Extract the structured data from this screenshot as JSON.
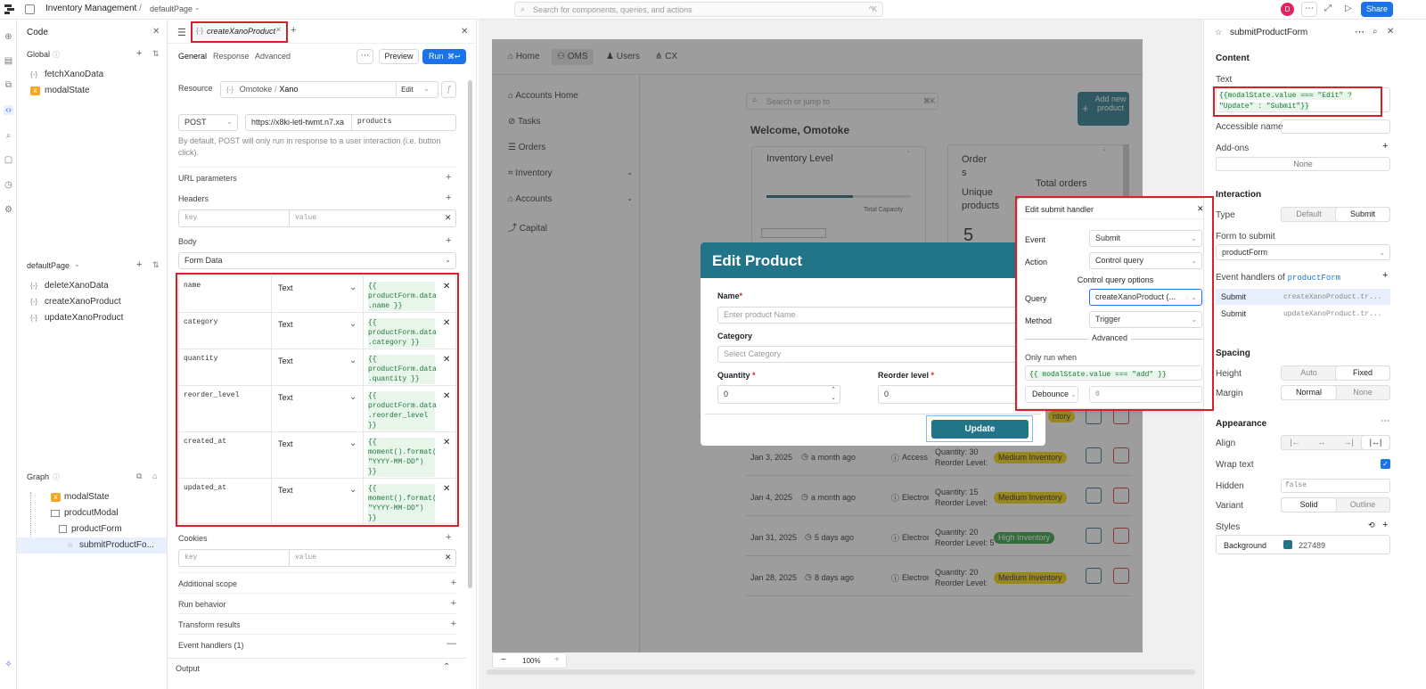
{
  "topbar": {
    "app_title": "Inventory Management",
    "separator": "/",
    "page": "defaultPage",
    "search_placeholder": "Search for components, queries, and actions",
    "search_shortcut": "^K",
    "avatar_initial": "D",
    "share_label": "Share"
  },
  "left_panel": {
    "title": "Code",
    "global_label": "Global",
    "global_items": [
      {
        "label": "fetchXanoData",
        "icon": "query-icon"
      },
      {
        "label": "modalState",
        "icon": "variable-icon"
      }
    ],
    "page_label": "defaultPage",
    "page_items": [
      {
        "label": "deleteXanoData"
      },
      {
        "label": "createXanoProduct"
      },
      {
        "label": "updateXanoProduct"
      }
    ],
    "graph_label": "Graph",
    "graph_items": [
      {
        "label": "modalState"
      },
      {
        "label": "prodcutModal"
      },
      {
        "label": "productForm"
      },
      {
        "label": "submitProductFo..."
      }
    ]
  },
  "query_panel": {
    "tab_name": "createXanoProduct",
    "tabs": [
      "General",
      "Response",
      "Advanced"
    ],
    "preview_label": "Preview",
    "run_label": "Run",
    "run_shortcut": "⌘↩",
    "resource_label": "Resource",
    "resource_owner": "Omotoke",
    "resource_sep": "/",
    "resource_name": "Xano",
    "resource_edit": "Edit",
    "method": "POST",
    "url": "https://x8ki-letl-twmt.n7.xa",
    "path": "products",
    "post_note": "By default, POST will only run in response to a user interaction (i.e. button click).",
    "url_params_label": "URL parameters",
    "headers_label": "Headers",
    "key_placeholder": "key",
    "value_placeholder": "value",
    "body_label": "Body",
    "body_type": "Form Data",
    "body_rows": [
      {
        "key": "name",
        "type": "Text",
        "value": "{{ productForm.data .name }}"
      },
      {
        "key": "category",
        "type": "Text",
        "value": "{{ productForm.data .category }}"
      },
      {
        "key": "quantity",
        "type": "Text",
        "value": "{{ productForm.data .quantity }}"
      },
      {
        "key": "reorder_level",
        "type": "Text",
        "value": "{{ productForm.data .reorder_level }}"
      },
      {
        "key": "created_at",
        "type": "Text",
        "value": "{{ moment().format( \"YYYY-MM-DD\") }}"
      },
      {
        "key": "updated_at",
        "type": "Text",
        "value": "{{ moment().format( \"YYYY-MM-DD\") }}"
      }
    ],
    "cookies_label": "Cookies",
    "sections": [
      "Additional scope",
      "Run behavior",
      "Transform results",
      "Event handlers (1)"
    ],
    "output_label": "Output"
  },
  "app": {
    "nav": [
      "Home",
      "OMS",
      "Users",
      "CX"
    ],
    "sidebar": [
      "Accounts Home",
      "Tasks",
      "Orders",
      "Inventory",
      "Accounts",
      "Capital"
    ],
    "search_placeholder": "Search or jump to",
    "search_shortcut": "⌘K",
    "add_button": "Add new product",
    "welcome": "Welcome, Omotoke",
    "inventory_card_title": "Inventory Level",
    "total_capacity": "Total Capacity",
    "orders_card_title": "Orders",
    "unique_products": "Unique products",
    "total_orders": "Total orders",
    "unique_count": "5",
    "inventory_fill": 0.6,
    "rows": [
      {
        "date": "Jan 3, 2025",
        "ago": "a month ago",
        "cat": "Access",
        "qty": "Quantity: 30",
        "reorder": "Reorder Level:",
        "status": "Medium Inventory"
      },
      {
        "date": "Jan 4, 2025",
        "ago": "a month ago",
        "cat": "Electron",
        "qty": "Quantity: 15",
        "reorder": "Reorder Level:",
        "status": "Medium Inventory"
      },
      {
        "date": "Jan 31, 2025",
        "ago": "5 days ago",
        "cat": "Electron",
        "qty": "Quantity: 20",
        "reorder": "Reorder Level: 5",
        "status": "High Inventory"
      },
      {
        "date": "Jan 28, 2025",
        "ago": "8 days ago",
        "cat": "Electron",
        "qty": "Quantity: 20",
        "reorder": "Reorder Level:",
        "status": "Medium Inventory"
      }
    ],
    "partial_status": "ntory",
    "zoom": "100%"
  },
  "modal": {
    "title": "Edit Product",
    "name_label": "Name",
    "name_placeholder": "Enter product Name",
    "category_label": "Category",
    "category_placeholder": "Select Category",
    "quantity_label": "Quantity",
    "quantity_value": "0",
    "reorder_label": "Reorder level",
    "reorder_value": "0",
    "required_mark": "*",
    "update_label": "Update"
  },
  "handler_popup": {
    "title": "Edit submit handler",
    "event_label": "Event",
    "event_value": "Submit",
    "action_label": "Action",
    "action_value": "Control query",
    "options_label": "Control query options",
    "query_label": "Query",
    "query_value": "createXanoProduct (...",
    "method_label": "Method",
    "method_value": "Trigger",
    "advanced_label": "Advanced",
    "only_run_label": "Only run when",
    "only_run_value": "{{ modalState.value === \"add\" }}",
    "debounce_label": "Debounce",
    "debounce_value": "0"
  },
  "inspector": {
    "title": "submitProductForm",
    "content_label": "Content",
    "text_label": "Text",
    "text_value": "{{modalState.value === \"Edit\" ? \"Update\" : \"Submit\"}}",
    "accessible_label": "Accessible name",
    "addons_label": "Add-ons",
    "addons_value": "None",
    "interaction_label": "Interaction",
    "type_label": "Type",
    "type_options": [
      "Default",
      "Submit"
    ],
    "form_label": "Form to submit",
    "form_value": "productForm",
    "handlers_label": "Event handlers of",
    "handlers_target": "productForm",
    "handlers": [
      {
        "event": "Submit",
        "query": "createXanoProduct.tr..."
      },
      {
        "event": "Submit",
        "query": "updateXanoProduct.tr..."
      }
    ],
    "spacing_label": "Spacing",
    "height_label": "Height",
    "height_options": [
      "Auto",
      "Fixed"
    ],
    "margin_label": "Margin",
    "margin_options": [
      "Normal",
      "None"
    ],
    "appearance_label": "Appearance",
    "align_label": "Align",
    "wrap_label": "Wrap text",
    "hidden_label": "Hidden",
    "hidden_value": "false",
    "variant_label": "Variant",
    "variant_options": [
      "Solid",
      "Outline"
    ],
    "styles_label": "Styles",
    "background_label": "Background",
    "background_value": "227489"
  },
  "colors": {
    "accent": "#1a73e8",
    "teal": "#227489",
    "highlight": "#d9202a"
  }
}
